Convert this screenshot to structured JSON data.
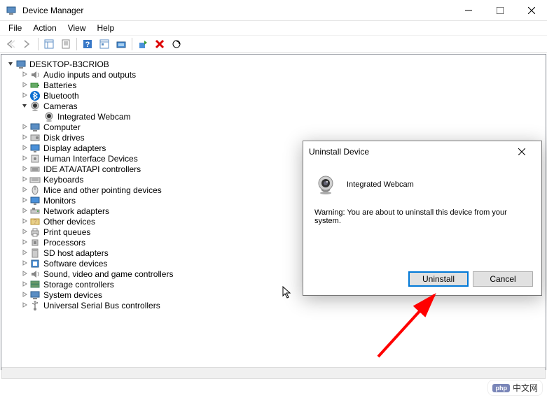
{
  "window": {
    "title": "Device Manager",
    "buttons": {
      "min": "Minimize",
      "max": "Maximize",
      "close": "Close"
    }
  },
  "menu": {
    "items": [
      "File",
      "Action",
      "View",
      "Help"
    ]
  },
  "tree": {
    "root": "DESKTOP-B3CRIOB",
    "nodes": [
      {
        "label": "Audio inputs and outputs",
        "icon": "speaker"
      },
      {
        "label": "Batteries",
        "icon": "battery"
      },
      {
        "label": "Bluetooth",
        "icon": "bluetooth"
      },
      {
        "label": "Cameras",
        "icon": "camera",
        "expanded": true,
        "children": [
          {
            "label": "Integrated Webcam",
            "icon": "camera"
          }
        ]
      },
      {
        "label": "Computer",
        "icon": "computer"
      },
      {
        "label": "Disk drives",
        "icon": "disk"
      },
      {
        "label": "Display adapters",
        "icon": "display"
      },
      {
        "label": "Human Interface Devices",
        "icon": "hid"
      },
      {
        "label": "IDE ATA/ATAPI controllers",
        "icon": "ide"
      },
      {
        "label": "Keyboards",
        "icon": "keyboard"
      },
      {
        "label": "Mice and other pointing devices",
        "icon": "mouse"
      },
      {
        "label": "Monitors",
        "icon": "monitor"
      },
      {
        "label": "Network adapters",
        "icon": "network"
      },
      {
        "label": "Other devices",
        "icon": "other"
      },
      {
        "label": "Print queues",
        "icon": "printer"
      },
      {
        "label": "Processors",
        "icon": "cpu"
      },
      {
        "label": "SD host adapters",
        "icon": "sd"
      },
      {
        "label": "Software devices",
        "icon": "software"
      },
      {
        "label": "Sound, video and game controllers",
        "icon": "sound"
      },
      {
        "label": "Storage controllers",
        "icon": "storage"
      },
      {
        "label": "System devices",
        "icon": "system"
      },
      {
        "label": "Universal Serial Bus controllers",
        "icon": "usb"
      }
    ]
  },
  "dialog": {
    "title": "Uninstall Device",
    "device": "Integrated Webcam",
    "warning": "Warning: You are about to uninstall this device from your system.",
    "buttons": {
      "uninstall": "Uninstall",
      "cancel": "Cancel"
    }
  },
  "watermark": {
    "brand": "php",
    "text": "中文网"
  }
}
